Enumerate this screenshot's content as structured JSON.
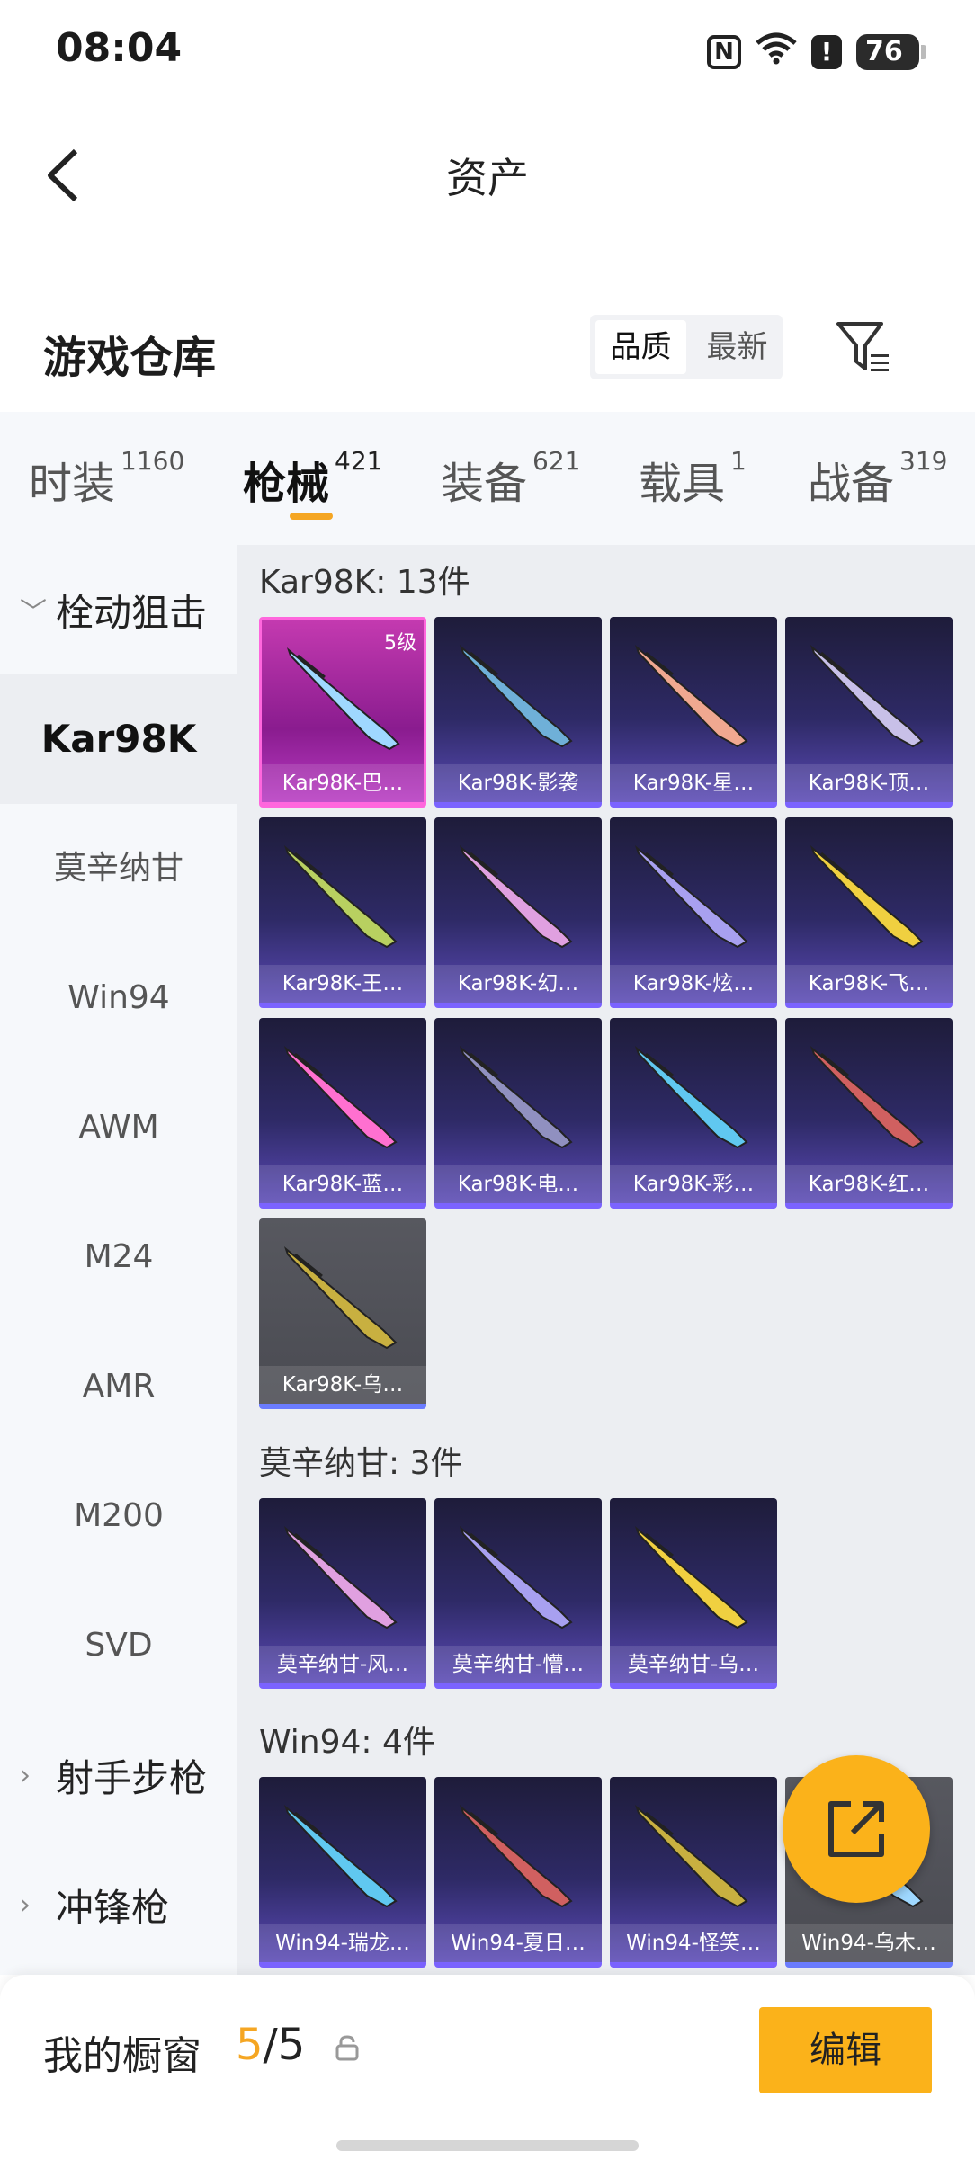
{
  "status": {
    "time": "08:04",
    "battery": "76",
    "wifi_icon": "wifi-6-icon"
  },
  "nav": {
    "title": "资产"
  },
  "warehouse": {
    "title": "游戏仓库",
    "sort_options": [
      "品质",
      "最新"
    ],
    "sort_selected": "品质"
  },
  "tabs": [
    {
      "label": "时装",
      "count": "1160"
    },
    {
      "label": "枪械",
      "count": "421",
      "active": true
    },
    {
      "label": "装备",
      "count": "621"
    },
    {
      "label": "载具",
      "count": "1"
    },
    {
      "label": "战备",
      "count": "319"
    }
  ],
  "sidebar": {
    "group_top": "栓动狙击",
    "items": [
      "Kar98K",
      "莫辛纳甘",
      "Win94",
      "AWM",
      "M24",
      "AMR",
      "M200",
      "SVD"
    ],
    "active_item": "Kar98K",
    "group_marksman": "射手步枪",
    "group_smg": "冲锋枪"
  },
  "groups": [
    {
      "title": "Kar98K: 13件",
      "items": [
        {
          "name": "Kar98K-巴…",
          "level": "5级",
          "style": "pink"
        },
        {
          "name": "Kar98K-影袭"
        },
        {
          "name": "Kar98K-星…"
        },
        {
          "name": "Kar98K-顶…"
        },
        {
          "name": "Kar98K-王…"
        },
        {
          "name": "Kar98K-幻…"
        },
        {
          "name": "Kar98K-炫…"
        },
        {
          "name": "Kar98K-飞…"
        },
        {
          "name": "Kar98K-蓝…"
        },
        {
          "name": "Kar98K-电…"
        },
        {
          "name": "Kar98K-彩…"
        },
        {
          "name": "Kar98K-红…"
        },
        {
          "name": "Kar98K-乌…",
          "style": "gray"
        }
      ]
    },
    {
      "title": "莫辛纳甘: 3件",
      "items": [
        {
          "name": "莫辛纳甘-风…"
        },
        {
          "name": "莫辛纳甘-懵…"
        },
        {
          "name": "莫辛纳甘-乌…"
        }
      ]
    },
    {
      "title": "Win94: 4件",
      "items": [
        {
          "name": "Win94-瑞龙…"
        },
        {
          "name": "Win94-夏日…"
        },
        {
          "name": "Win94-怪笑…"
        },
        {
          "name": "Win94-乌木…",
          "style": "gray"
        }
      ]
    }
  ],
  "showcase": {
    "label": "我的橱窗",
    "used": "5",
    "total": "/5",
    "edit_label": "编辑"
  },
  "colors": {
    "accent": "#fbb21a",
    "tab_underline": "#f5a623",
    "card_purple": "#2e2a66",
    "card_pink": "#c43ab0"
  }
}
